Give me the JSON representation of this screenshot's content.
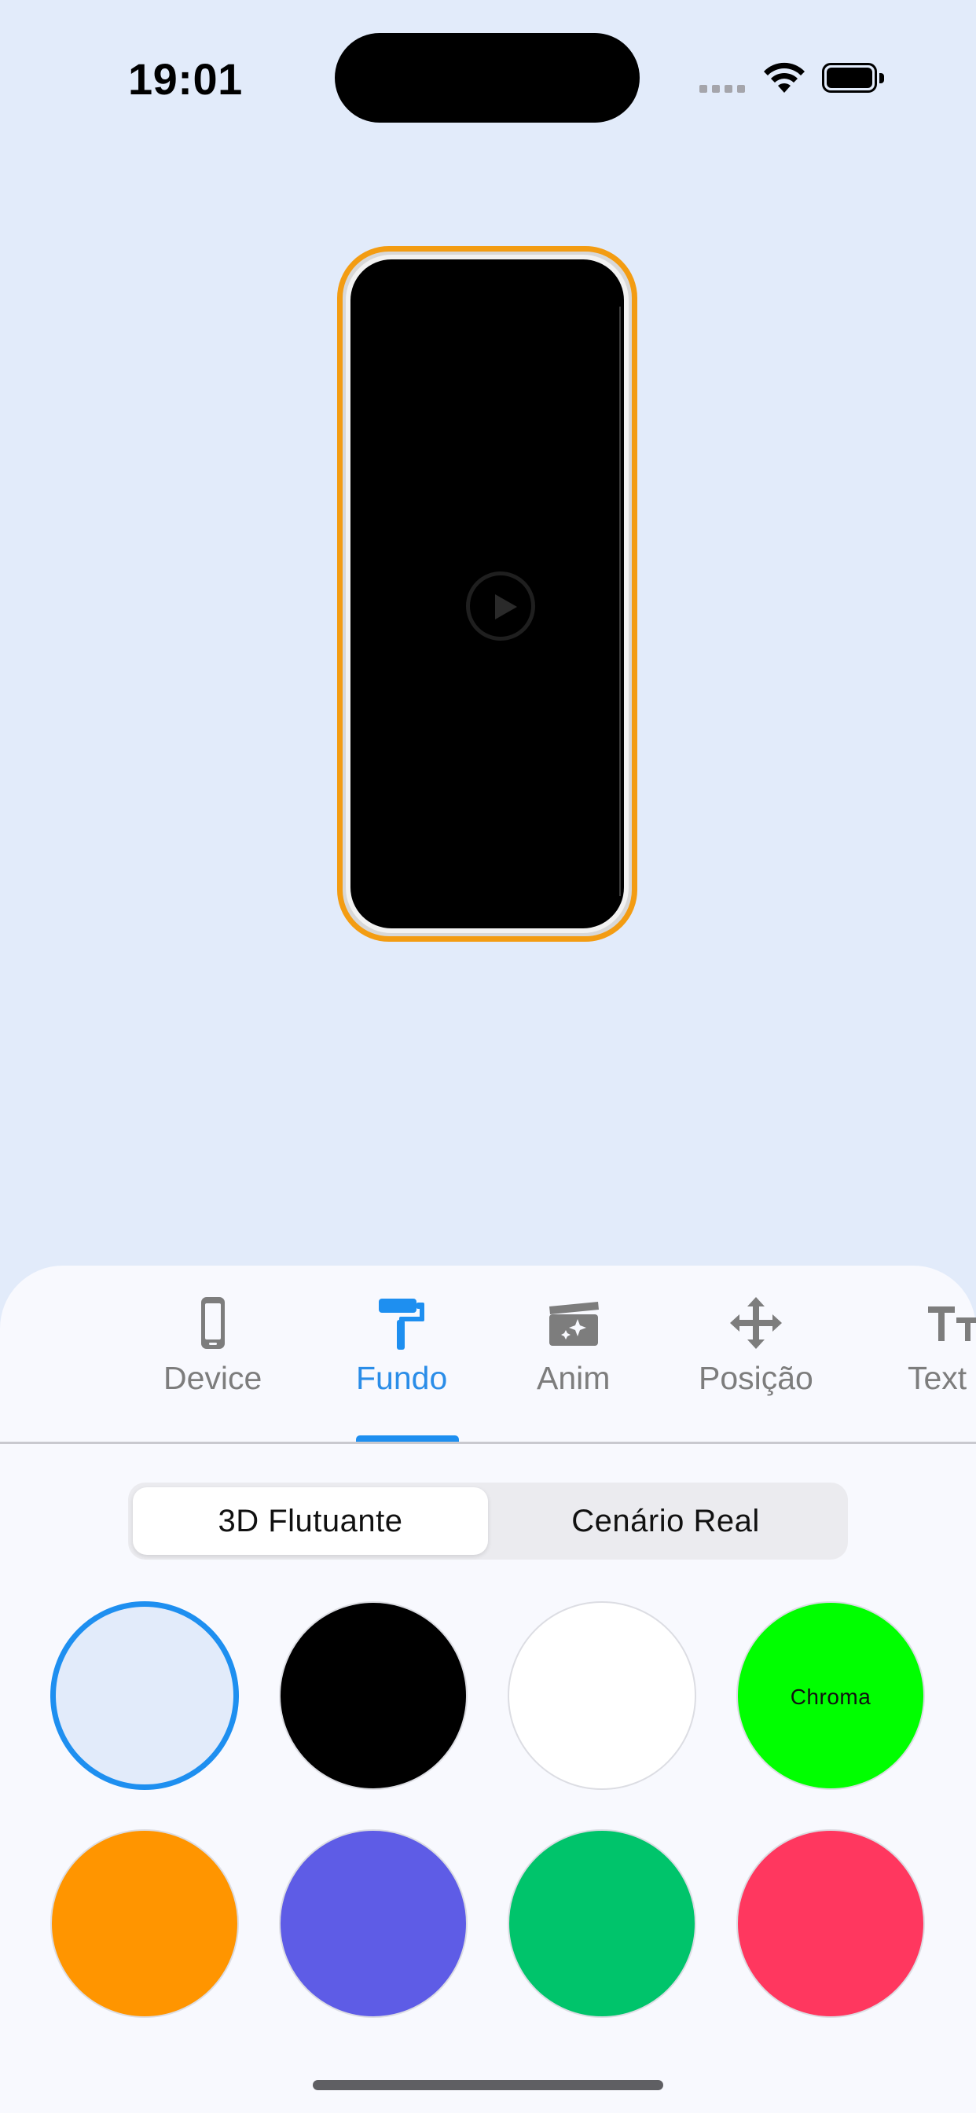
{
  "status_bar": {
    "time": "19:01"
  },
  "preview": {
    "frame_color": "#f39c12",
    "screen_color": "#000000"
  },
  "tabs": [
    {
      "label": "Device",
      "icon": "phone-icon",
      "active": false
    },
    {
      "label": "Fundo",
      "icon": "paint-roller-icon",
      "active": true
    },
    {
      "label": "Anim",
      "icon": "clapperboard-sparkles-icon",
      "active": false
    },
    {
      "label": "Posição",
      "icon": "move-arrows-icon",
      "active": false
    },
    {
      "label": "Text",
      "icon": "text-size-icon",
      "active": false
    }
  ],
  "segmented": {
    "options": [
      "3D Flutuante",
      "Cenário Real"
    ],
    "selected_index": 0
  },
  "swatches": [
    {
      "color": "#e2ebfa",
      "label": "",
      "selected": true
    },
    {
      "color": "#000000",
      "label": "",
      "selected": false
    },
    {
      "color": "#ffffff",
      "label": "",
      "selected": false
    },
    {
      "color": "#00ff00",
      "label": "Chroma",
      "selected": false
    },
    {
      "color": "#ff9500",
      "label": "",
      "selected": false
    },
    {
      "color": "#5e5ce6",
      "label": "",
      "selected": false
    },
    {
      "color": "#00c46b",
      "label": "",
      "selected": false
    },
    {
      "color": "#ff375f",
      "label": "",
      "selected": false
    }
  ],
  "colors": {
    "accent": "#1e8ff0",
    "background": "#e2ebfa"
  }
}
